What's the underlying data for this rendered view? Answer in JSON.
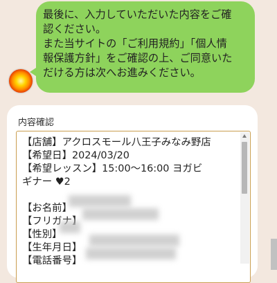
{
  "chat": {
    "avatar_icon": "sun-avatar-icon",
    "message": "最後に、入力していただいた内容をご確\n認ください。\nまた当サイトの「ご利用規約」「個人情\n報保護方針」をご確認の上、ご同意いた\nだける方は次へお進みください。"
  },
  "form": {
    "label": "内容確認",
    "content": "【店舗】アクロスモール八王子みなみ野店\n【希望日】2024/03/20\n【希望レッスン】15:00～16:00 ヨガビ\nギナー ♥2\n\n【お名前】\n【フリガナ】\n【性別】\n【生年月日】\n【電話番号】"
  },
  "colors": {
    "page_bg": "#f3e8df",
    "bubble_bg": "#8ed35c",
    "card_bg": "#ffffff",
    "textarea_border": "#c99d4e"
  }
}
